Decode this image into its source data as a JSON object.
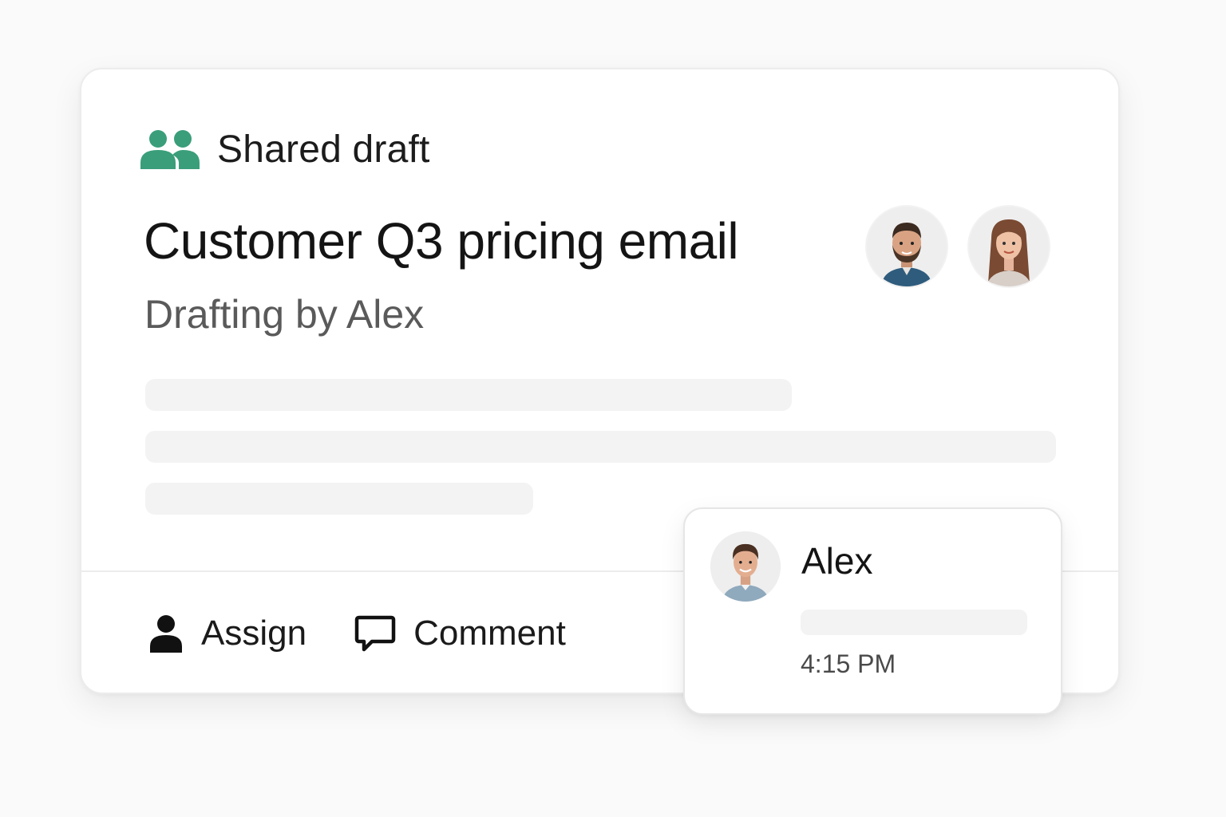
{
  "card": {
    "header_label": "Shared draft",
    "header_icon": "people-icon",
    "title": "Customer Q3 pricing email",
    "subtitle": "Drafting by Alex",
    "accent_color": "#3a9e7a",
    "collaborators": [
      {
        "avatar": "avatar-man-bearded"
      },
      {
        "avatar": "avatar-woman"
      }
    ]
  },
  "actions": [
    {
      "label": "Assign",
      "icon": "person-icon"
    },
    {
      "label": "Comment",
      "icon": "speech-bubble-icon"
    }
  ],
  "comment": {
    "author": "Alex",
    "time": "4:15 PM"
  }
}
